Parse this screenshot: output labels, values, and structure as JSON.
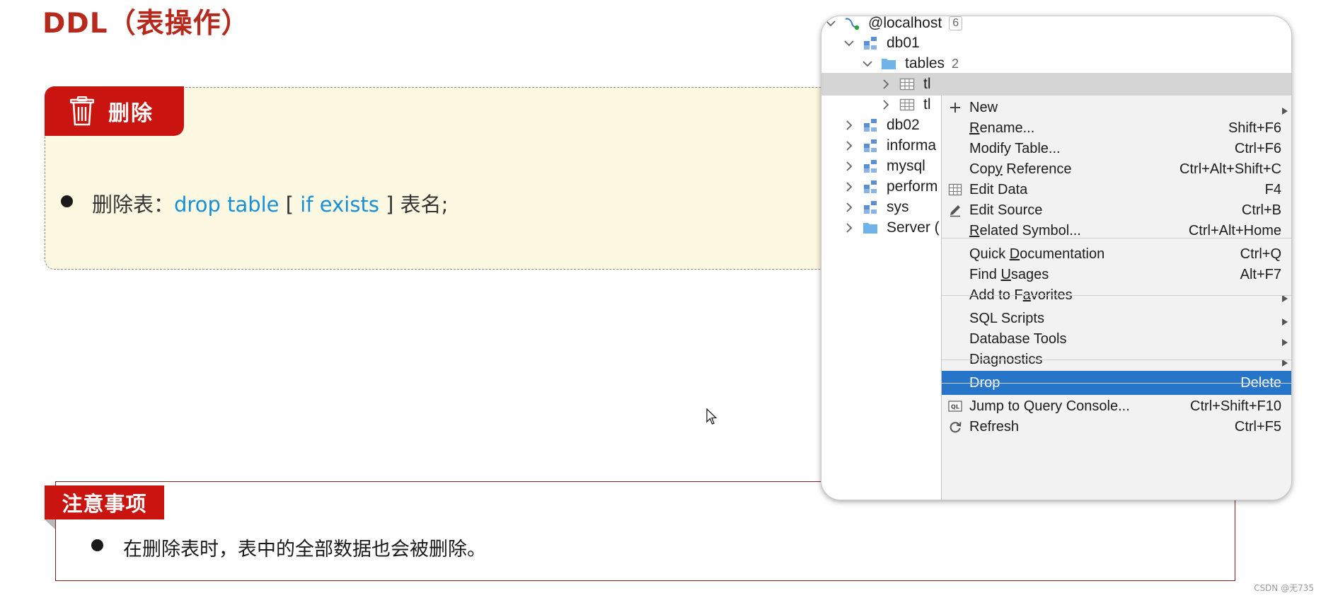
{
  "slide": {
    "title": "DDL（表操作）",
    "delete_section": {
      "tab_label": "删除",
      "icon": "trash-icon",
      "line_prefix": "删除表：",
      "line_kw1": "drop table",
      "line_bracket_open": " [ ",
      "line_kw2": "if exists",
      "line_suffix": " ] 表名;"
    },
    "note_section": {
      "tab_label": "注意事项",
      "text": "在删除表时，表中的全部数据也会被删除。"
    },
    "watermark": "CSDN @无735"
  },
  "ide": {
    "tree": [
      {
        "label": "@localhost",
        "count": "6",
        "icon": "mysql-datasource-icon",
        "expanded": true
      },
      {
        "label": "db01",
        "icon": "schema-icon",
        "expanded": true
      },
      {
        "label": "tables",
        "count": "2",
        "icon": "folder-icon",
        "expanded": true
      },
      {
        "label": "tl",
        "icon": "table-icon",
        "expanded": false,
        "selected": true
      },
      {
        "label": "tl",
        "icon": "table-icon",
        "expanded": false
      },
      {
        "label": "db02",
        "icon": "schema-icon",
        "expanded": false
      },
      {
        "label": "informa",
        "icon": "schema-icon",
        "expanded": false
      },
      {
        "label": "mysql",
        "icon": "schema-icon",
        "expanded": false
      },
      {
        "label": "perform",
        "icon": "schema-icon",
        "expanded": false
      },
      {
        "label": "sys",
        "icon": "schema-icon",
        "expanded": false
      },
      {
        "label": "Server (",
        "icon": "folder-icon",
        "expanded": false
      }
    ],
    "menu": [
      {
        "label": "New",
        "icon": "plus-icon",
        "submenu": true
      },
      {
        "label": "Rename...",
        "shortcut": "Shift+F6"
      },
      {
        "label": "Modify Table...",
        "shortcut": "Ctrl+F6"
      },
      {
        "label": "Copy Reference",
        "shortcut": "Ctrl+Alt+Shift+C"
      },
      {
        "label": "Edit Data",
        "icon": "table-grid-icon",
        "shortcut": "F4"
      },
      {
        "label": "Edit Source",
        "icon": "pencil-icon",
        "shortcut": "Ctrl+B"
      },
      {
        "label": "Related Symbol...",
        "shortcut": "Ctrl+Alt+Home"
      },
      {
        "label": "Quick Documentation",
        "shortcut": "Ctrl+Q"
      },
      {
        "label": "Find Usages",
        "shortcut": "Alt+F7"
      },
      {
        "label": "Add to Favorites",
        "submenu": true
      },
      {
        "label": "SQL Scripts",
        "submenu": true
      },
      {
        "label": "Database Tools",
        "submenu": true
      },
      {
        "label": "Diagnostics",
        "submenu": true
      },
      {
        "label": "Drop",
        "shortcut": "Delete",
        "active": true
      },
      {
        "label": "Jump to Query Console...",
        "icon": "ql-icon",
        "shortcut": "Ctrl+Shift+F10"
      },
      {
        "label": "Refresh",
        "icon": "refresh-icon",
        "shortcut": "Ctrl+F5"
      }
    ]
  },
  "colors": {
    "title": "#b52a1d",
    "tab_red": "#c9140f",
    "keyword_blue": "#1790d8",
    "menu_highlight": "#2675c9",
    "box_bg": "#fdf8e1"
  }
}
